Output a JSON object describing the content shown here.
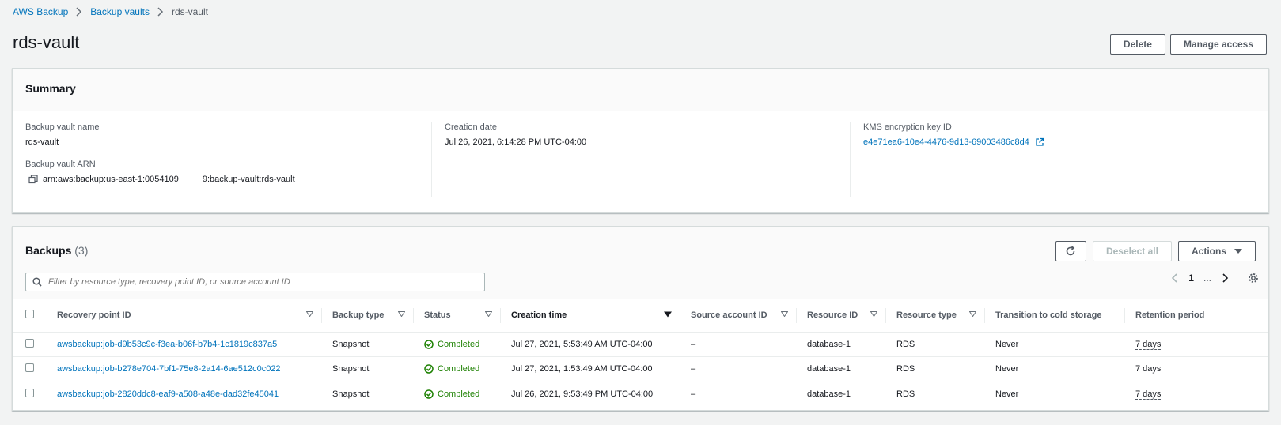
{
  "breadcrumb": [
    "AWS Backup",
    "Backup vaults",
    "rds-vault"
  ],
  "title": "rds-vault",
  "header_buttons": {
    "delete": "Delete",
    "manage": "Manage access"
  },
  "summary": {
    "heading": "Summary",
    "vault_name_label": "Backup vault name",
    "vault_name": "rds-vault",
    "arn_label": "Backup vault ARN",
    "arn_part1": "arn:aws:backup:us-east-1:0054109",
    "arn_part2": "9:backup-vault:rds-vault",
    "creation_label": "Creation date",
    "creation_value": "Jul 26, 2021, 6:14:28 PM UTC-04:00",
    "kms_label": "KMS encryption key ID",
    "kms_value": "e4e71ea6-10e4-4476-9d13-69003486c8d4"
  },
  "backups": {
    "title": "Backups",
    "count": "(3)",
    "deselect": "Deselect all",
    "actions": "Actions",
    "search_placeholder": "Filter by resource type, recovery point ID, or source account ID",
    "page": "1",
    "more": "...",
    "columns": [
      "Recovery point ID",
      "Backup type",
      "Status",
      "Creation time",
      "Source account ID",
      "Resource ID",
      "Resource type",
      "Transition to cold storage",
      "Retention period"
    ],
    "rows": [
      {
        "id": "awsbackup:job-d9b53c9c-f3ea-b06f-b7b4-1c1819c837a5",
        "type": "Snapshot",
        "status": "Completed",
        "created": "Jul 27, 2021, 5:53:49 AM UTC-04:00",
        "source": "–",
        "resource_id": "database-1",
        "resource_type": "RDS",
        "cold": "Never",
        "retention": "7 days"
      },
      {
        "id": "awsbackup:job-b278e704-7bf1-75e8-2a14-6ae512c0c022",
        "type": "Snapshot",
        "status": "Completed",
        "created": "Jul 27, 2021, 1:53:49 AM UTC-04:00",
        "source": "–",
        "resource_id": "database-1",
        "resource_type": "RDS",
        "cold": "Never",
        "retention": "7 days"
      },
      {
        "id": "awsbackup:job-2820ddc8-eaf9-a508-a48e-dad32fe45041",
        "type": "Snapshot",
        "status": "Completed",
        "created": "Jul 26, 2021, 9:53:49 PM UTC-04:00",
        "source": "–",
        "resource_id": "database-1",
        "resource_type": "RDS",
        "cold": "Never",
        "retention": "7 days"
      }
    ]
  },
  "icons": {
    "copy": "copy-icon",
    "external": "external-link-icon",
    "refresh": "refresh-icon",
    "search": "search-icon",
    "settings": "gear-icon",
    "status": "check-circle-icon"
  },
  "colors": {
    "link": "#0073bb",
    "success": "#1d8102",
    "bg": "#f2f3f3"
  }
}
